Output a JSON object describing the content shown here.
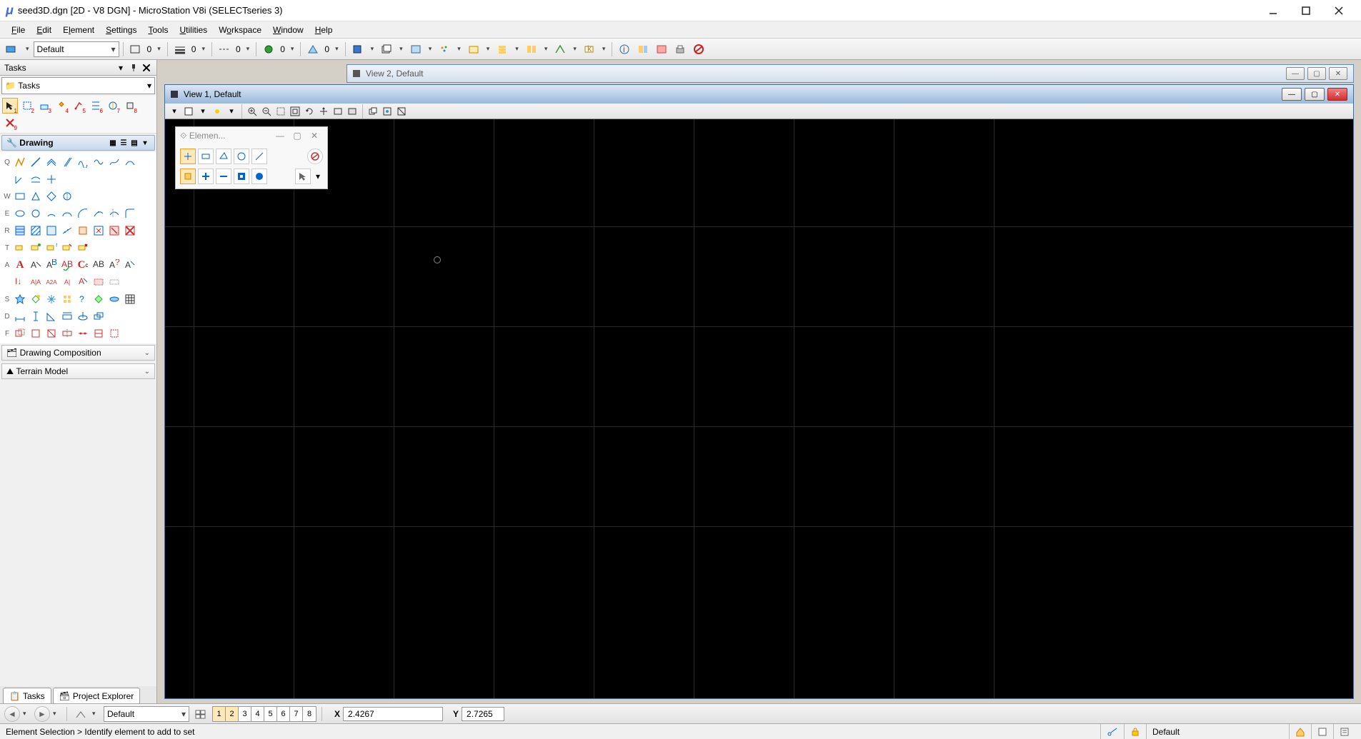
{
  "title": "seed3D.dgn [2D - V8 DGN] - MicroStation V8i (SELECTseries 3)",
  "menu": [
    "File",
    "Edit",
    "Element",
    "Settings",
    "Tools",
    "Utilities",
    "Workspace",
    "Window",
    "Help"
  ],
  "toolbar": {
    "level_dropdown": "Default",
    "attr1_value": "0",
    "attr2_value": "0",
    "attr3_value": "0",
    "attr4_value": "0",
    "attr5_value": "0"
  },
  "tasks": {
    "panel_title": "Tasks",
    "dropdown_label": "Tasks",
    "drawing_label": "Drawing",
    "collapse1": "Drawing Composition",
    "collapse2": "Terrain Model",
    "tab1": "Tasks",
    "tab2": "Project Explorer",
    "row_letters": [
      "Q",
      "W",
      "E",
      "R",
      "T",
      "A",
      "S",
      "D",
      "F"
    ]
  },
  "views": {
    "view2_title": "View 2, Default",
    "view1_title": "View 1, Default"
  },
  "elem_float": {
    "title": "Elemen..."
  },
  "bottom": {
    "level": "Default",
    "view_numbers": [
      "1",
      "2",
      "3",
      "4",
      "5",
      "6",
      "7",
      "8"
    ],
    "active_views": [
      1,
      2
    ],
    "x_label": "X",
    "y_label": "Y",
    "x_value": "2.4267",
    "y_value": "2.7265"
  },
  "status": {
    "message": "Element Selection > Identify element to add to set",
    "level": "Default"
  }
}
